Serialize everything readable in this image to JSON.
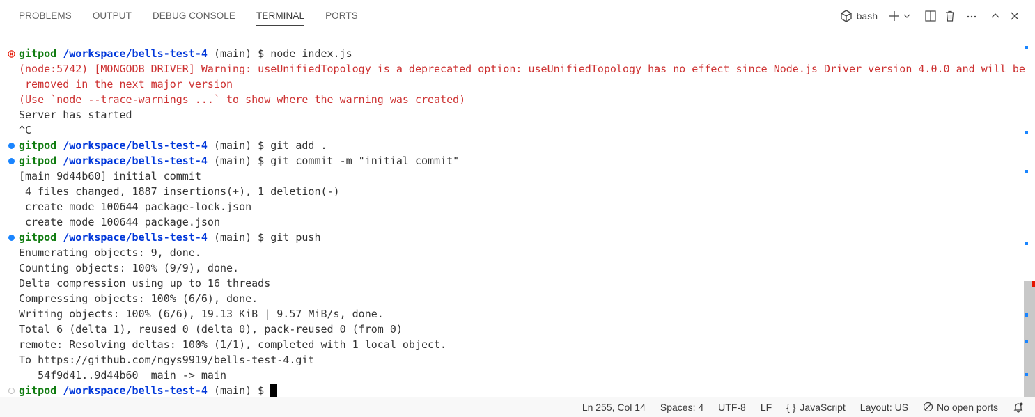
{
  "panel": {
    "tabs": [
      "PROBLEMS",
      "OUTPUT",
      "DEBUG CONSOLE",
      "TERMINAL",
      "PORTS"
    ],
    "active_tab": "TERMINAL",
    "terminal_name": "bash",
    "action_icons": [
      "terminal-icon",
      "plus-icon",
      "chevron-down-icon",
      "split-icon",
      "trash-icon",
      "more-icon",
      "chevron-up-icon",
      "close-icon"
    ]
  },
  "terminal": {
    "lines": [
      {
        "deco": "error",
        "prompt": {
          "user": "gitpod",
          "path": "/workspace/bells-test-4",
          "rest": " (main) $ node index.js"
        }
      },
      {
        "text": "(node:5742) [MONGODB DRIVER] Warning: useUnifiedTopology is a deprecated option: useUnifiedTopology has no effect since Node.js Driver version 4.0.0 and will be",
        "style": "warn"
      },
      {
        "text": " removed in the next major version",
        "style": "warn"
      },
      {
        "text": "(Use `node --trace-warnings ...` to show where the warning was created)",
        "style": "warn"
      },
      {
        "text": "Server has started"
      },
      {
        "text": "^C"
      },
      {
        "deco": "success",
        "prompt": {
          "user": "gitpod",
          "path": "/workspace/bells-test-4",
          "rest": " (main) $ git add ."
        }
      },
      {
        "deco": "success",
        "prompt": {
          "user": "gitpod",
          "path": "/workspace/bells-test-4",
          "rest": " (main) $ git commit -m \"initial commit\""
        }
      },
      {
        "text": "[main 9d44b60] initial commit"
      },
      {
        "text": " 4 files changed, 1887 insertions(+), 1 deletion(-)"
      },
      {
        "text": " create mode 100644 package-lock.json"
      },
      {
        "text": " create mode 100644 package.json"
      },
      {
        "deco": "success",
        "prompt": {
          "user": "gitpod",
          "path": "/workspace/bells-test-4",
          "rest": " (main) $ git push"
        }
      },
      {
        "text": "Enumerating objects: 9, done."
      },
      {
        "text": "Counting objects: 100% (9/9), done."
      },
      {
        "text": "Delta compression using up to 16 threads"
      },
      {
        "text": "Compressing objects: 100% (6/6), done."
      },
      {
        "text": "Writing objects: 100% (6/6), 19.13 KiB | 9.57 MiB/s, done."
      },
      {
        "text": "Total 6 (delta 1), reused 0 (delta 0), pack-reused 0 (from 0)"
      },
      {
        "text": "remote: Resolving deltas: 100% (1/1), completed with 1 local object."
      },
      {
        "text": "To https://github.com/ngys9919/bells-test-4.git"
      },
      {
        "text": "   54f9d41..9d44b60  main -> main"
      },
      {
        "deco": "default",
        "prompt": {
          "user": "gitpod",
          "path": "/workspace/bells-test-4",
          "rest": " (main) $ "
        },
        "cursor": true
      }
    ]
  },
  "status_bar": {
    "position": "Ln 255, Col 14",
    "spaces": "Spaces: 4",
    "encoding": "UTF-8",
    "eol": "LF",
    "language_icon": "{ }",
    "language": "JavaScript",
    "layout": "Layout: US",
    "ports": "No open ports"
  },
  "colors": {
    "user_green": "#107c10",
    "path_blue": "#0037da",
    "warning_red": "#cd3131",
    "success_dot": "#1a85ff",
    "error_deco": "#e51400"
  }
}
